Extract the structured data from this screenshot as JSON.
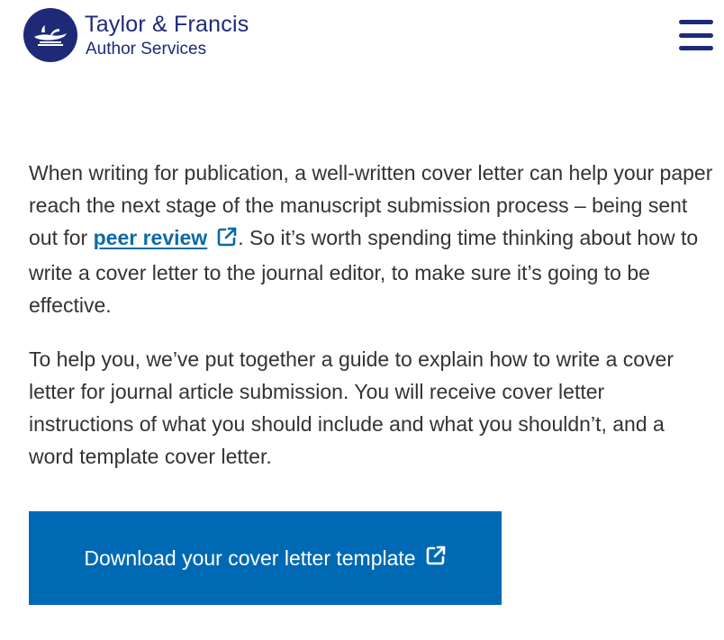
{
  "header": {
    "brand_title": "Taylor & Francis",
    "brand_subtitle": "Author Services",
    "menu_icon": "hamburger-menu-icon"
  },
  "main": {
    "paragraph1": {
      "before_link": "When writing for publication, a well-written cover letter can help your paper reach the next stage of the manuscript submission process – being sent out for ",
      "link_text": "peer review",
      "after_link": ". So it’s worth spending time thinking about how to write a cover letter to the journal editor, to make sure it’s going to be effective."
    },
    "paragraph2": "To help you, we’ve put together a guide to explain how to write a cover letter for journal article submission. You will receive cover letter instructions of what you should include and what you shouldn’t, and a word template cover letter.",
    "download_button_label": "Download your cover letter template"
  },
  "colors": {
    "brand_navy": "#1e2a78",
    "link_blue": "#0a6aa6",
    "button_blue": "#0069b4",
    "text": "#333333"
  }
}
